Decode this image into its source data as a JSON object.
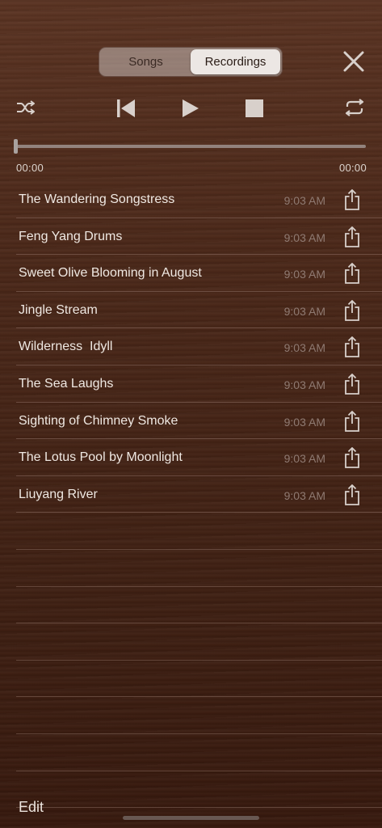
{
  "segmented": {
    "songs_label": "Songs",
    "recordings_label": "Recordings",
    "selected": "Recordings"
  },
  "icons": {
    "close": "close-icon",
    "shuffle": "shuffle-icon",
    "previous": "skip-previous-icon",
    "play": "play-icon",
    "stop": "stop-icon",
    "repeat": "repeat-icon",
    "share": "share-icon"
  },
  "player": {
    "current_time": "00:00",
    "total_time": "00:00",
    "progress": 0
  },
  "recordings": [
    {
      "title": "The Wandering Songstress",
      "time": "9:03 AM"
    },
    {
      "title": "Feng Yang Drums",
      "time": "9:03 AM"
    },
    {
      "title": "Sweet Olive Blooming in August",
      "time": "9:03 AM"
    },
    {
      "title": "Jingle Stream",
      "time": "9:03 AM"
    },
    {
      "title": "Wilderness  Idyll",
      "time": "9:03 AM"
    },
    {
      "title": "The Sea Laughs",
      "time": "9:03 AM"
    },
    {
      "title": "Sighting of Chimney Smoke",
      "time": "9:03 AM"
    },
    {
      "title": "The Lotus Pool by Moonlight",
      "time": "9:03 AM"
    },
    {
      "title": "Liuyang River",
      "time": "9:03 AM"
    }
  ],
  "footer": {
    "edit_label": "Edit"
  }
}
